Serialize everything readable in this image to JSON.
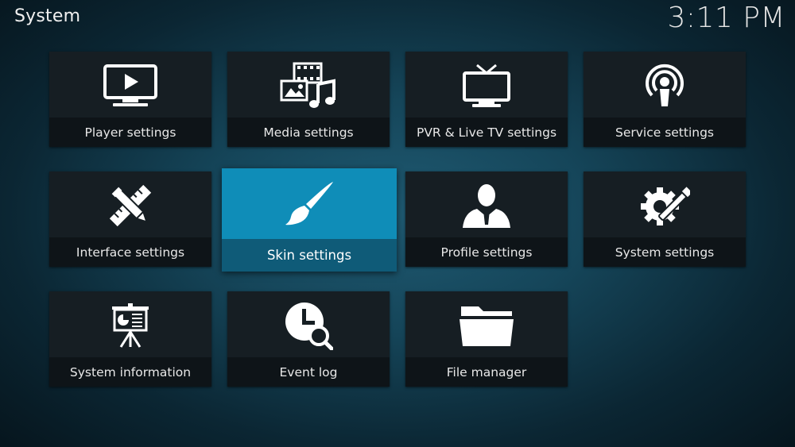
{
  "window": {
    "title": "System",
    "clock": "3:11 PM"
  },
  "tiles": [
    {
      "label": "Player settings",
      "icon": "monitor-play-icon"
    },
    {
      "label": "Media settings",
      "icon": "media-icon"
    },
    {
      "label": "PVR & Live TV settings",
      "icon": "tv-icon"
    },
    {
      "label": "Service settings",
      "icon": "podcast-icon"
    },
    {
      "label": "Interface settings",
      "icon": "pencil-ruler-icon"
    },
    {
      "label": "Skin settings",
      "icon": "paintbrush-icon",
      "focused": true
    },
    {
      "label": "Profile settings",
      "icon": "user-silhouette-icon"
    },
    {
      "label": "System settings",
      "icon": "gear-wrench-icon"
    },
    {
      "label": "System information",
      "icon": "presentation-board-icon"
    },
    {
      "label": "Event log",
      "icon": "clock-search-icon"
    },
    {
      "label": "File manager",
      "icon": "folder-icon"
    }
  ],
  "colors": {
    "focus": "#0d8ab2",
    "tile": "#121a1f",
    "background": "#154559"
  }
}
